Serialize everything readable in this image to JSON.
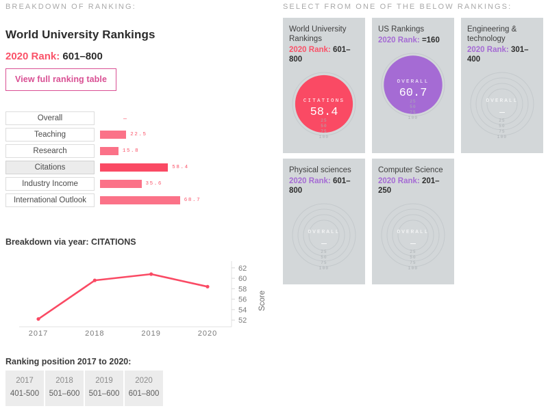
{
  "left": {
    "caption": "BREAKDOWN OF RANKING:",
    "title": "World University Rankings",
    "rank_label": "2020 Rank:",
    "rank_value": "601–800",
    "view_button": "View full ranking table",
    "breakdown": {
      "rows": [
        {
          "label": "Overall",
          "value": "–",
          "numeric": null,
          "selected": false
        },
        {
          "label": "Teaching",
          "value": "22.5",
          "numeric": 22.5,
          "selected": false
        },
        {
          "label": "Research",
          "value": "15.8",
          "numeric": 15.8,
          "selected": false
        },
        {
          "label": "Citations",
          "value": "58.4",
          "numeric": 58.4,
          "selected": true
        },
        {
          "label": "Industry Income",
          "value": "35.6",
          "numeric": 35.6,
          "selected": false
        },
        {
          "label": "International Outlook",
          "value": "68.7",
          "numeric": 68.7,
          "selected": false
        }
      ]
    },
    "linechart_title": "Breakdown via year: CITATIONS",
    "position_title": "Ranking position 2017 to 2020:",
    "position_table": {
      "headers": [
        "2017",
        "2018",
        "2019",
        "2020"
      ],
      "values": [
        "401-500",
        "501–600",
        "501–600",
        "601–800"
      ]
    }
  },
  "right": {
    "caption": "SELECT FROM ONE OF THE BELOW RANKINGS:",
    "cards": [
      {
        "title": "World University Rankings",
        "rank_label": "2020 Rank:",
        "rank_value": "601–800",
        "accent": "pink",
        "dial": {
          "metric": "CITATIONS",
          "value": "58.4",
          "numeric": 58.4,
          "filled": true,
          "color": "#fa4a64"
        },
        "ticks": [
          "25",
          "50",
          "75",
          "100"
        ]
      },
      {
        "title": "US Rankings",
        "rank_label": "2020 Rank:",
        "rank_value": "=160",
        "accent": "purple",
        "dial": {
          "metric": "OVERALL",
          "value": "60.7",
          "numeric": 60.7,
          "filled": true,
          "color": "#a56bd4"
        },
        "ticks": [
          "25",
          "50",
          "75",
          "100"
        ]
      },
      {
        "title": "Engineering & technology",
        "rank_label": "2020 Rank:",
        "rank_value": "301–400",
        "accent": "purple",
        "dial": {
          "metric": "OVERALL",
          "value": "—",
          "numeric": null,
          "filled": false,
          "color": "#c6cace"
        },
        "ticks": [
          "25",
          "50",
          "75",
          "100"
        ]
      },
      {
        "title": "Physical sciences",
        "rank_label": "2020 Rank:",
        "rank_value": "601–800",
        "accent": "purple",
        "dial": {
          "metric": "OVERALL",
          "value": "—",
          "numeric": null,
          "filled": false,
          "color": "#c6cace"
        },
        "ticks": [
          "25",
          "50",
          "75",
          "100"
        ]
      },
      {
        "title": "Computer Science",
        "rank_label": "2020 Rank:",
        "rank_value": "201–250",
        "accent": "purple",
        "dial": {
          "metric": "OVERALL",
          "value": "—",
          "numeric": null,
          "filled": false,
          "color": "#c6cace"
        },
        "ticks": [
          "25",
          "50",
          "75",
          "100"
        ]
      }
    ]
  },
  "colors": {
    "accent_pink": "#fa5268",
    "bar_strong": "#fa4a64",
    "bar_light": "#fb7288",
    "accent_purple": "#a56bd4",
    "button_border": "#d94f93",
    "card_bg": "#d3d7d9",
    "caption_gray": "#a8a8a8"
  },
  "chart_data": [
    {
      "type": "bar",
      "title": "Breakdown of ranking",
      "orientation": "horizontal",
      "categories": [
        "Overall",
        "Teaching",
        "Research",
        "Citations",
        "Industry Income",
        "International Outlook"
      ],
      "values": [
        null,
        22.5,
        15.8,
        58.4,
        35.6,
        68.7
      ],
      "value_labels": [
        "–",
        "22.5",
        "15.8",
        "58.4",
        "35.6",
        "68.7"
      ],
      "highlighted": "Citations",
      "xlabel": "",
      "ylabel": "",
      "xlim": [
        0,
        100
      ],
      "grid": false,
      "legend": "none"
    },
    {
      "type": "line",
      "title": "Breakdown via year: CITATIONS",
      "x": [
        "2017",
        "2018",
        "2019",
        "2020"
      ],
      "series": [
        {
          "name": "CITATIONS",
          "values": [
            52.2,
            59.6,
            60.8,
            58.4
          ],
          "color": "#fa4a64"
        }
      ],
      "xlabel": "",
      "ylabel": "Score",
      "ylim": [
        51.5,
        62.5
      ],
      "yticks": [
        52,
        54,
        56,
        58,
        60,
        62
      ],
      "grid": false,
      "legend": "none",
      "markers": true
    },
    {
      "type": "table",
      "title": "Ranking position 2017 to 2020:",
      "columns": [
        "2017",
        "2018",
        "2019",
        "2020"
      ],
      "rows": [
        [
          "401-500",
          "501–600",
          "501–600",
          "601–800"
        ]
      ]
    }
  ]
}
